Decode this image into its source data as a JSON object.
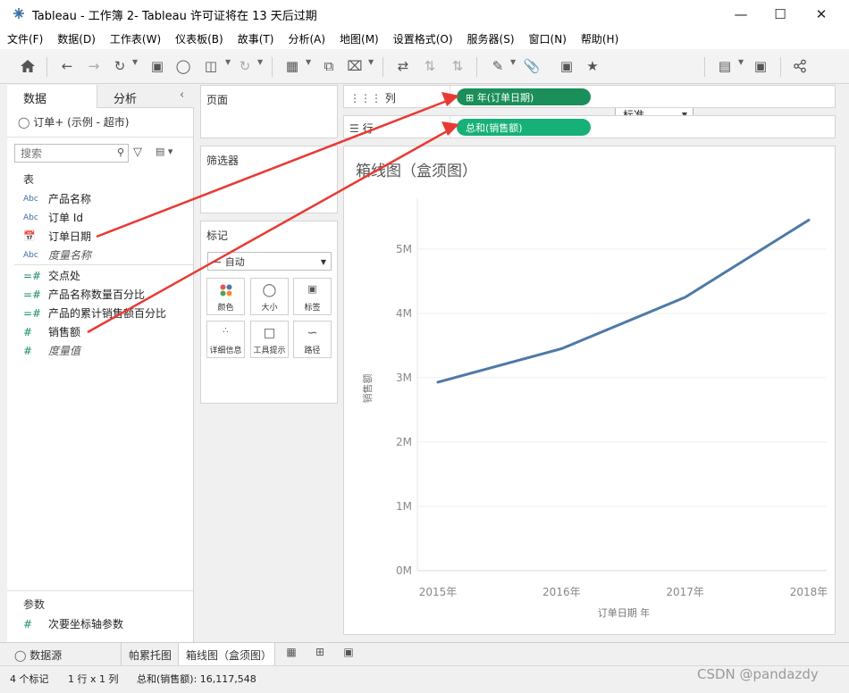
{
  "window": {
    "title": "Tableau - 工作簿 2- Tableau 许可证将在 13 天后过期"
  },
  "menu": [
    "文件(F)",
    "数据(D)",
    "工作表(W)",
    "仪表板(B)",
    "故事(T)",
    "分析(A)",
    "地图(M)",
    "设置格式(O)",
    "服务器(S)",
    "窗口(N)",
    "帮助(H)"
  ],
  "toolbar": {
    "fit_value": "标准"
  },
  "data_pane": {
    "tab_data": "数据",
    "tab_analysis": "分析",
    "datasource": "订单+ (示例 - 超市)",
    "search_placeholder": "搜索",
    "section_table": "表",
    "dimensions": [
      {
        "icon": "Abc",
        "label": "产品名称"
      },
      {
        "icon": "Abc",
        "label": "订单 Id"
      },
      {
        "icon": "calendar",
        "label": "订单日期"
      },
      {
        "icon": "Abc",
        "label": "度量名称"
      }
    ],
    "measures": [
      {
        "icon": "=#",
        "label": "交点处"
      },
      {
        "icon": "=#",
        "label": "产品名称数量百分比"
      },
      {
        "icon": "=#",
        "label": "产品的累计销售额百分比"
      },
      {
        "icon": "#",
        "label": "销售额"
      },
      {
        "icon": "#",
        "label": "度量值"
      }
    ],
    "section_params": "参数",
    "params": [
      {
        "icon": "#",
        "label": "次要坐标轴参数"
      }
    ]
  },
  "cards": {
    "pages": "页面",
    "filters": "筛选器",
    "marks": "标记",
    "mark_type": "自动",
    "mark_buttons": [
      "颜色",
      "大小",
      "标签",
      "详细信息",
      "工具提示",
      "路径"
    ]
  },
  "shelves": {
    "columns_label": "列",
    "rows_label": "行",
    "column_pill": "年(订单日期)",
    "row_pill": "总和(销售额)"
  },
  "chart_data": {
    "type": "line",
    "title": "箱线图（盒须图）",
    "xlabel": "订单日期 年",
    "ylabel": "销售额",
    "categories": [
      "2015年",
      "2016年",
      "2017年",
      "2018年"
    ],
    "values": [
      2930000,
      3450000,
      4250000,
      5450000
    ],
    "yticks": [
      0,
      1000000,
      2000000,
      3000000,
      4000000,
      5000000
    ],
    "ytick_labels": [
      "0M",
      "1M",
      "2M",
      "3M",
      "4M",
      "5M"
    ],
    "ylim": [
      0,
      5650000
    ],
    "line_color": "#4e79a7",
    "grid": "horizontal"
  },
  "sheet_tabs": {
    "datasource": "数据源",
    "sheet1": "帕累托图",
    "sheet2": "箱线图（盒须图）"
  },
  "status": {
    "marks": "4 个标记",
    "rowscols": "1 行 x 1 列",
    "sum": "总和(销售额): 16,117,548"
  },
  "watermark": "CSDN @pandazdy"
}
